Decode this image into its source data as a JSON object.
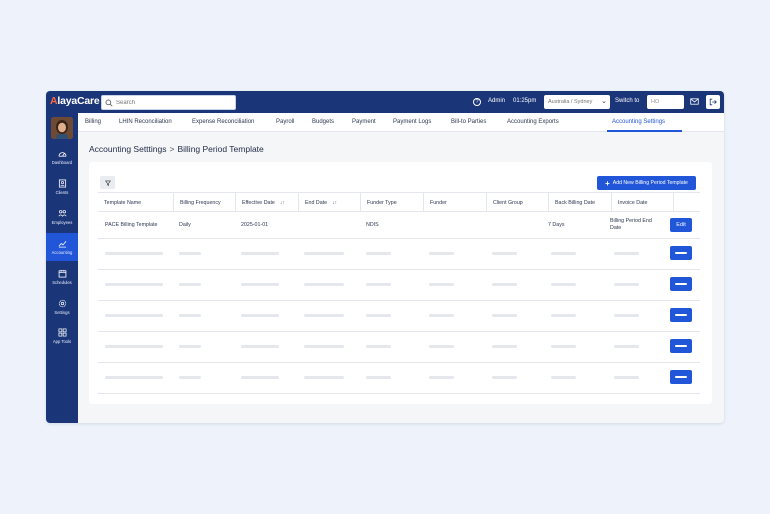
{
  "app": {
    "logo_prefix": "A",
    "logo_rest": "layaCare",
    "search_placeholder": "Search",
    "help": "?",
    "user": "Admin",
    "time": "01:25pm",
    "timezone": "Australia / Sydney",
    "switch_label": "Switch to",
    "switch_value": "HO"
  },
  "sidebar": {
    "items": [
      {
        "label": "Dashboard",
        "icon": "dashboard-icon"
      },
      {
        "label": "Clients",
        "icon": "clients-icon"
      },
      {
        "label": "Employees",
        "icon": "employees-icon"
      },
      {
        "label": "Accounting",
        "icon": "accounting-icon",
        "active": true
      },
      {
        "label": "Schedules",
        "icon": "calendar-icon"
      },
      {
        "label": "Settings",
        "icon": "gear-icon"
      },
      {
        "label": "App Tools",
        "icon": "grid-icon"
      }
    ]
  },
  "tabs": [
    "Billing",
    "LHIN Reconciliation",
    "Expense Reconciliation",
    "Payroll",
    "Budgets",
    "Payment",
    "Payment Logs",
    "Bill-to Parties",
    "Accounting Exports",
    "Accounting Settings"
  ],
  "active_tab": "Accounting Settings",
  "breadcrumb": {
    "parent": "Accounting Setttings",
    "separator": ">",
    "current": "Billing Period Template"
  },
  "toolbar": {
    "add_button": "Add New Billing Period Template",
    "add_icon": "+"
  },
  "table": {
    "columns": [
      "Template Name",
      "Billing Frequency",
      "Effective Date",
      "End Date",
      "Funder Type",
      "Funder",
      "Client Group",
      "Back Billing Date",
      "Invoice Date"
    ],
    "sort_icon": "↓↑",
    "rows": [
      {
        "template_name": "PACE Billing Template",
        "billing_frequency": "Daily",
        "effective_date": "2025-01-01",
        "end_date": "",
        "funder_type": "NDIS",
        "funder": "",
        "client_group": "",
        "back_billing_date": "7 Days",
        "invoice_date": "Billing Period End Date",
        "action": "Edit"
      }
    ]
  },
  "colors": {
    "brand": "#1a3578",
    "accent": "#2156d8",
    "logo_accent": "#ff6a3d"
  }
}
